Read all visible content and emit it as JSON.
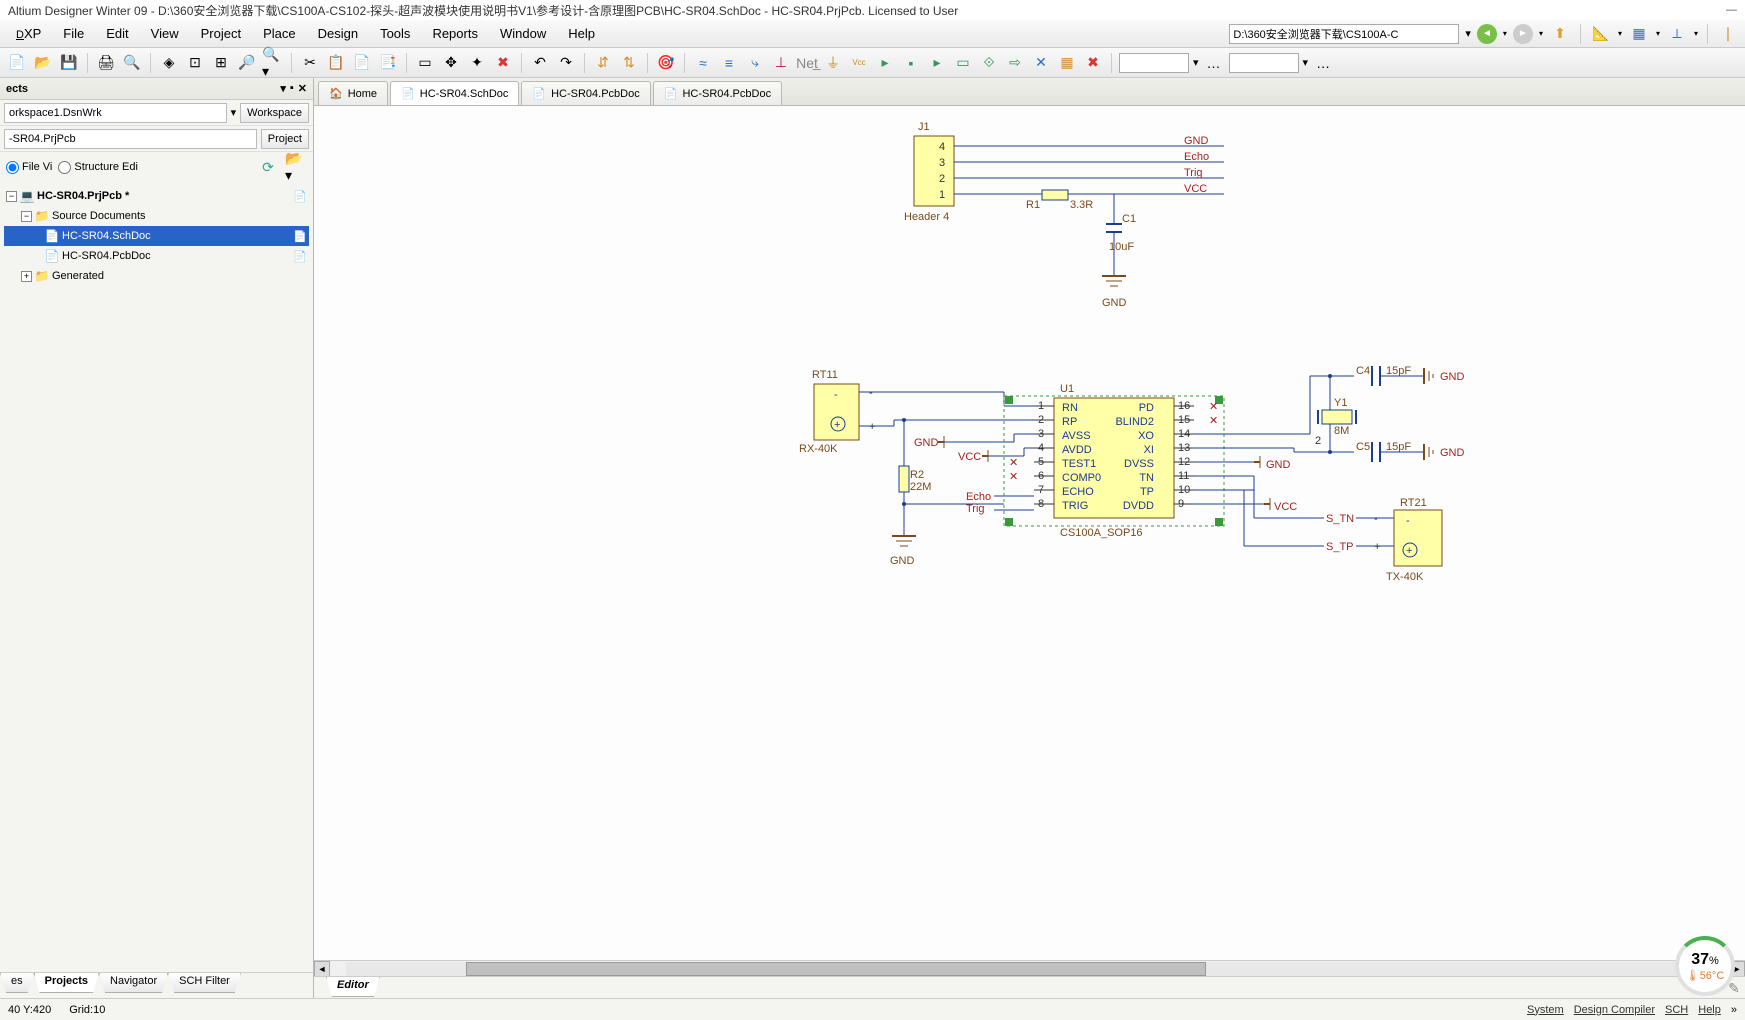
{
  "title": "Altium Designer Winter 09 - D:\\360安全浏览器下载\\CS100A-CS102-探头-超声波模块使用说明书V1\\参考设计-含原理图PCB\\HC-SR04.SchDoc - HC-SR04.PrjPcb. Licensed to User",
  "menu": {
    "dxp": "DXP",
    "file": "File",
    "edit": "Edit",
    "view": "View",
    "project": "Project",
    "place": "Place",
    "design": "Design",
    "tools": "Tools",
    "reports": "Reports",
    "window": "Window",
    "help": "Help"
  },
  "path_field": "D:\\360安全浏览器下载\\CS100A-C",
  "panel": {
    "title": "ects",
    "workspace": "orkspace1.DsnWrk",
    "workspace_btn": "Workspace",
    "project": "-SR04.PrjPcb",
    "project_btn": "Project",
    "view_opts": {
      "file": "File Vi",
      "structure": "Structure Edi"
    }
  },
  "tree": {
    "root": "HC-SR04.PrjPcb *",
    "src": "Source Documents",
    "sch": "HC-SR04.SchDoc",
    "pcb": "HC-SR04.PcbDoc",
    "gen": "Generated"
  },
  "tabs": {
    "home": "Home",
    "t1": "HC-SR04.SchDoc",
    "t2": "HC-SR04.PcbDoc",
    "t3": "HC-SR04.PcbDoc"
  },
  "bottom_tabs_left": {
    "es": "es",
    "projects": "Projects",
    "navigator": "Navigator",
    "schfilter": "SCH Filter"
  },
  "bottom_tabs_right": {
    "editor": "Editor"
  },
  "status": {
    "xy": "40  Y:420",
    "grid": "Grid:10",
    "system": "System",
    "design": "Design Compiler",
    "sch": "SCH",
    "help": "Help"
  },
  "perf": {
    "pct": "37",
    "pct_unit": "%",
    "temp": "56°C"
  },
  "schematic": {
    "header": {
      "designator": "J1",
      "label": "Header 4",
      "pins": [
        "4",
        "3",
        "2",
        "1"
      ],
      "nets": [
        "GND",
        "Echo",
        "Trig",
        "VCC"
      ]
    },
    "r1": {
      "d": "R1",
      "v": "3.3R"
    },
    "c1": {
      "d": "C1",
      "v": "10uF"
    },
    "gnd": "GND",
    "vcc": "VCC",
    "rt11": {
      "d": "RT11",
      "label": "RX-40K",
      "minus": "-",
      "plus": "+"
    },
    "r2": {
      "d": "R2",
      "v": "22M"
    },
    "echo": "Echo",
    "trig": "Trig",
    "u1": {
      "designator": "U1",
      "footprint": "CS100A_SOP16",
      "left_pins": [
        "1",
        "2",
        "3",
        "4",
        "5",
        "6",
        "7",
        "8"
      ],
      "left_labels": [
        "RN",
        "RP",
        "AVSS",
        "AVDD",
        "TEST1",
        "COMP0",
        "ECHO",
        "TRIG"
      ],
      "right_pins": [
        "16",
        "15",
        "14",
        "13",
        "12",
        "11",
        "10",
        "9"
      ],
      "right_labels": [
        "PD",
        "BLIND2",
        "XO",
        "XI",
        "DVSS",
        "TN",
        "TP",
        "DVDD"
      ]
    },
    "c4": {
      "d": "C4",
      "v": "15pF"
    },
    "c5": {
      "d": "C5",
      "v": "15pF"
    },
    "y1": {
      "d": "Y1",
      "v": "8M",
      "pin2": "2"
    },
    "rt21": {
      "d": "RT21",
      "label": "TX-40K",
      "minus": "-",
      "plus": "+"
    },
    "s_tn": "S_TN",
    "s_tp": "S_TP"
  }
}
